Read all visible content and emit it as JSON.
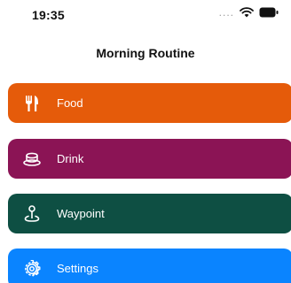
{
  "status_bar": {
    "time": "19:35",
    "dots": "....",
    "wifi_icon": "wifi-icon",
    "battery_icon": "battery-icon"
  },
  "nav": {
    "title": "Morning Routine"
  },
  "menu": {
    "items": [
      {
        "label": "Food",
        "icon": "fork-knife-icon",
        "color": "#E55B0A"
      },
      {
        "label": "Drink",
        "icon": "cup-icon",
        "color": "#8B1455"
      },
      {
        "label": "Waypoint",
        "icon": "map-pin-icon",
        "color": "#0E4F43"
      },
      {
        "label": "Settings",
        "icon": "gear-icon",
        "color": "#0A84FF"
      }
    ]
  }
}
